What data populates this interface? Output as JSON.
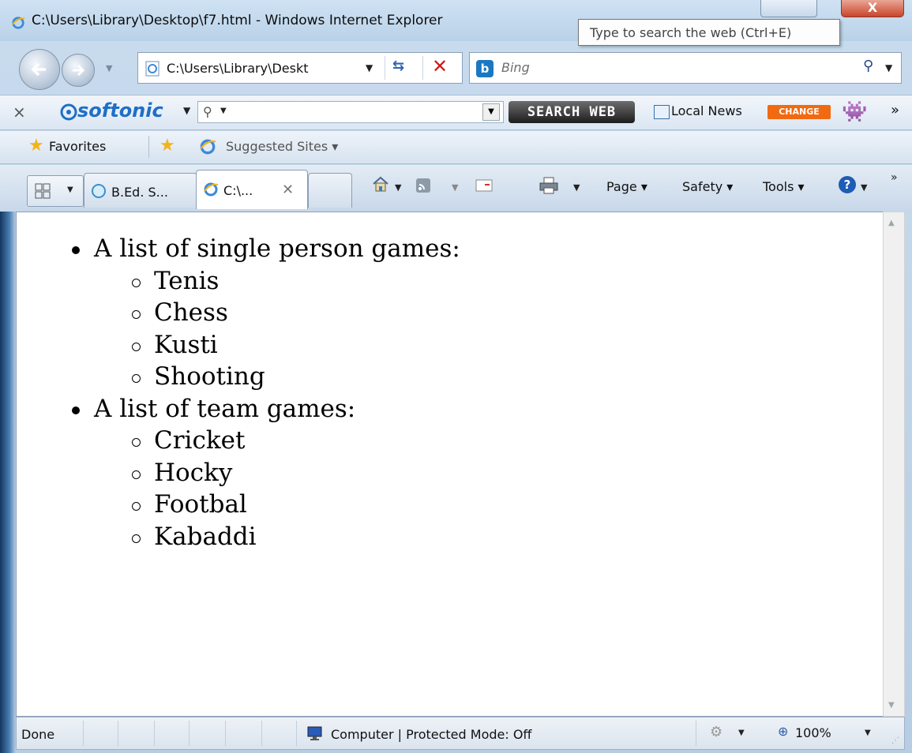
{
  "window": {
    "title": "C:\\Users\\Library\\Desktop\\f7.html - Windows Internet Explorer",
    "tooltip": "Type to search the web (Ctrl+E)",
    "close_glyph": "X"
  },
  "address_bar": {
    "url": "C:\\Users\\Library\\Deskt",
    "search_placeholder": "Bing"
  },
  "softonic_toolbar": {
    "logo": "softonic",
    "search_web_button": "SEARCH WEB",
    "local_news": "Local News",
    "change_badge": "CHANGE"
  },
  "favorites_bar": {
    "favorites_label": "Favorites",
    "suggested_sites": "Suggested Sites ▾"
  },
  "tabs": [
    {
      "label": "B.Ed. S..."
    },
    {
      "label": "C:\\..."
    }
  ],
  "command_bar": {
    "page": "Page ▾",
    "safety": "Safety ▾",
    "tools": "Tools ▾"
  },
  "page_content": {
    "groups": [
      {
        "heading": "A list of single person games:",
        "items": [
          "Tenis",
          "Chess",
          "Kusti",
          "Shooting"
        ]
      },
      {
        "heading": "A list of team games:",
        "items": [
          "Cricket",
          "Hocky",
          "Footbal",
          "Kabaddi"
        ]
      }
    ]
  },
  "status_bar": {
    "status": "Done",
    "zone": "Computer | Protected Mode: Off",
    "zoom": "100%"
  }
}
